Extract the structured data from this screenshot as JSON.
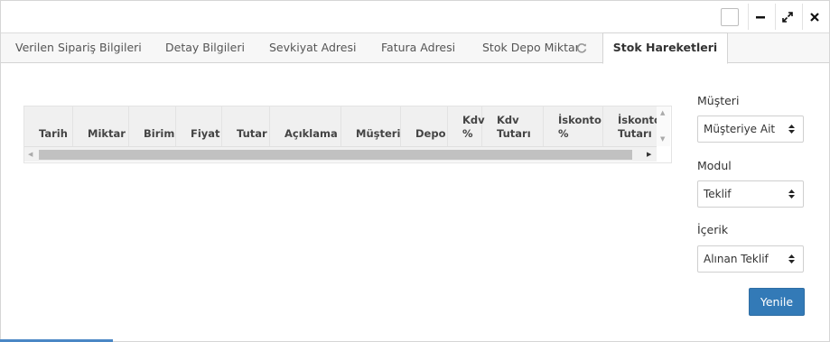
{
  "titlebar": {
    "minimize_icon": "minus-icon",
    "maximize_icon": "expand-icon",
    "close_icon": "close-icon"
  },
  "tabs": [
    {
      "label": "Verilen Sipariş Bilgileri"
    },
    {
      "label": "Detay Bilgileri"
    },
    {
      "label": "Sevkiyat Adresi"
    },
    {
      "label": "Fatura Adresi"
    },
    {
      "label": "Stok Depo Miktar"
    },
    {
      "label": "Stok Hareketleri",
      "active": true
    }
  ],
  "grid": {
    "columns": [
      {
        "line1": "",
        "line2": "Tarih"
      },
      {
        "line1": "",
        "line2": "Miktar"
      },
      {
        "line1": "",
        "line2": "Birim"
      },
      {
        "line1": "",
        "line2": "Fiyat"
      },
      {
        "line1": "",
        "line2": "Tutar"
      },
      {
        "line1": "",
        "line2": "Açıklama"
      },
      {
        "line1": "",
        "line2": "Müşteri"
      },
      {
        "line1": "",
        "line2": "Depo"
      },
      {
        "line1": "Kdv",
        "line2": "%"
      },
      {
        "line1": "Kdv",
        "line2": "Tutarı"
      },
      {
        "line1": "İskonto",
        "line2": "%"
      },
      {
        "line1": "İskonto",
        "line2": "Tutarı"
      }
    ]
  },
  "filters": {
    "musteri": {
      "label": "Müşteri",
      "value": "Müşteriye Ait"
    },
    "modul": {
      "label": "Modul",
      "value": "Teklif"
    },
    "icerik": {
      "label": "İçerik",
      "value": "Alınan Teklif"
    }
  },
  "refresh_button": {
    "label": "Yenile"
  },
  "colors": {
    "primary": "#337ab7",
    "accent": "#4a87c5"
  }
}
